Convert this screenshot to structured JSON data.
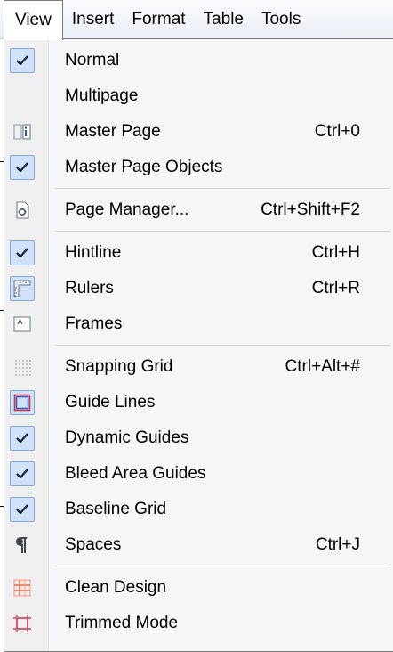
{
  "menubar": {
    "items": [
      {
        "label": "View"
      },
      {
        "label": "Insert"
      },
      {
        "label": "Format"
      },
      {
        "label": "Table"
      },
      {
        "label": "Tools"
      }
    ]
  },
  "view_menu": {
    "items": [
      {
        "label": "Normal",
        "shortcut": "",
        "icon": "check-icon",
        "checked": true
      },
      {
        "label": "Multipage",
        "shortcut": "",
        "icon": "",
        "checked": false
      },
      {
        "label": "Master Page",
        "shortcut": "Ctrl+0",
        "icon": "master-page-icon",
        "checked": false
      },
      {
        "label": "Master Page Objects",
        "shortcut": "",
        "icon": "check-icon",
        "checked": true
      },
      {
        "separator": true
      },
      {
        "label": "Page Manager...",
        "shortcut": "Ctrl+Shift+F2",
        "icon": "page-manager-icon",
        "checked": false
      },
      {
        "separator": true
      },
      {
        "label": "Hintline",
        "shortcut": "Ctrl+H",
        "icon": "check-icon",
        "checked": true
      },
      {
        "label": "Rulers",
        "shortcut": "Ctrl+R",
        "icon": "rulers-icon",
        "checked": true
      },
      {
        "label": "Frames",
        "shortcut": "",
        "icon": "frames-icon",
        "checked": false
      },
      {
        "separator": true
      },
      {
        "label": "Snapping Grid",
        "shortcut": "Ctrl+Alt+#",
        "icon": "snapping-grid-icon",
        "checked": false
      },
      {
        "label": "Guide Lines",
        "shortcut": "",
        "icon": "guide-lines-icon",
        "checked": true
      },
      {
        "label": "Dynamic Guides",
        "shortcut": "",
        "icon": "check-icon",
        "checked": true
      },
      {
        "label": "Bleed Area Guides",
        "shortcut": "",
        "icon": "check-icon",
        "checked": true
      },
      {
        "label": "Baseline Grid",
        "shortcut": "",
        "icon": "check-icon",
        "checked": true
      },
      {
        "label": "Spaces",
        "shortcut": "Ctrl+J",
        "icon": "pilcrow-icon",
        "checked": false
      },
      {
        "separator": true
      },
      {
        "label": "Clean Design",
        "shortcut": "",
        "icon": "clean-design-icon",
        "checked": false
      },
      {
        "label": "Trimmed Mode",
        "shortcut": "",
        "icon": "trimmed-mode-icon",
        "checked": false
      }
    ]
  },
  "colors": {
    "check_bg": "#cfe2f7",
    "check_border": "#7fa8d6",
    "menu_bg": "#f5f6f7"
  }
}
